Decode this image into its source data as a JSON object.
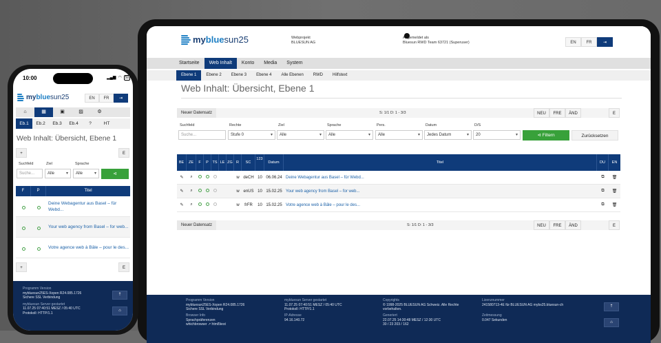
{
  "brand": {
    "my": "my",
    "blue": "blue",
    "sun": "sun25"
  },
  "header": {
    "project_label": "Webprojekt",
    "project_value": "BLUESUN AG",
    "login_label": "Angemeldet als",
    "login_value": "Bluesun RWD Team 63721 (Superuser)",
    "lang_en": "EN",
    "lang_fr": "FR",
    "exit_icon": "⇥"
  },
  "nav": [
    "Startseite",
    "Web Inhalt",
    "Konto",
    "Media",
    "System"
  ],
  "subnav": [
    "Ebene 1",
    "Ebene 2",
    "Ebene 3",
    "Ebene 4",
    "Alle Ebenen",
    "RWD",
    "Hilfstext"
  ],
  "page_title": "Web Inhalt: Übersicht, Ebene 1",
  "toolbar": {
    "new_record": "Neuer Datensatz",
    "page_info": "S: 1/1   D: 1 - 3/3",
    "seg": [
      "NEU",
      "FRE",
      "ÄND"
    ],
    "e_button": "E"
  },
  "filters": {
    "labels": [
      "Suchfeld",
      "Rechte",
      "Ziel",
      "Sprache",
      "Pers.",
      "Datum",
      "D/S"
    ],
    "search_placeholder": "Suche...",
    "values": [
      "Stufe 0",
      "Alle",
      "Alle",
      "Alle",
      "Jedes Datum",
      "20"
    ],
    "filter_button": "Filtern",
    "reset_button": "Zurücksetzen"
  },
  "table": {
    "headers": [
      "BE",
      "ZE",
      "F",
      "P",
      "TS",
      "LE",
      "ZG",
      "R",
      "SC",
      "123",
      "Datum",
      "Titel",
      "DU",
      "EN"
    ],
    "rows": [
      {
        "r": "w",
        "sc": "deCH",
        "n": "10",
        "date": "06.06.24",
        "title": "Deine Webagentur aus Basel – für Webd..."
      },
      {
        "r": "w",
        "sc": "enUS",
        "n": "10",
        "date": "15.02.25",
        "title": "Your web agency from Basel – for web..."
      },
      {
        "r": "w",
        "sc": "frFR",
        "n": "10",
        "date": "15.02.25",
        "title": "Votre agence web à Bâle – pour le des..."
      }
    ]
  },
  "bottom_toolbar": {
    "new_record": "Neuer Datensatz",
    "page_info": "S: 1/1    D: 1 - 3/3"
  },
  "footer": {
    "col1": [
      "Programm Version",
      "mybluesun25ES-Xopen R24.085.1726",
      "Sichere SSL Verbindung"
    ],
    "col2": [
      "mybluesun Server gestartet",
      "11.07.25 07:40:51 MESZ / 05:40 UTC",
      "Protokoll: HTTP/1.1"
    ],
    "col3": [
      "Copyrights",
      "© 1998-2025 BLUESUN AG Schweiz. Alle Rechte",
      "vorbehalten."
    ],
    "col4": [
      "Lizenznummer",
      "241580713-4E für BLUESUN AG",
      "mybs25.bluesun-ch"
    ],
    "col5": [
      "Browser Info",
      "Sprachpräferenzen",
      "whichbrowser",
      "html5test"
    ],
    "col6": [
      "IP-Adresse",
      "94.16.140.72"
    ],
    "col7": [
      "Generiert",
      "22.07.25 14:30:48 MESZ / 12:30 UTC",
      "30 / 23    203 / 162"
    ],
    "col8": [
      "Zeitmessung",
      "0.047 Sekunden"
    ],
    "up_icon": "⇡",
    "home_icon": "⌂"
  },
  "phone": {
    "time": "10:00",
    "battery": "50",
    "subnav": [
      "Eb.1",
      "Eb.2",
      "Eb.3",
      "Eb.4",
      "?",
      "HT"
    ],
    "title": "Web Inhalt: Übersicht, Ebene 1",
    "plus": "+",
    "e": "E",
    "filter_labels": [
      "Suchfeld",
      "Ziel",
      "Sprache"
    ],
    "search_placeholder": "Suche...",
    "filter_values": [
      "Alle",
      "Alle"
    ],
    "headers": [
      "F",
      "P",
      "Titel"
    ],
    "rows": [
      "Deine Webagentur aus Basel – für Webd...",
      "Your web agency from Basel – for web...",
      "Votre agence web à Bâle – pour le des..."
    ],
    "footer": [
      "Programm Version",
      "mybluesun25ES-Xopen R24.085.1726",
      "Sichere SSL Verbindung",
      "mybluesun Server gestartet",
      "11.07.25 07:40:51 MESZ / 05:40 UTC",
      "Protokoll: HTTP/1.1"
    ]
  }
}
